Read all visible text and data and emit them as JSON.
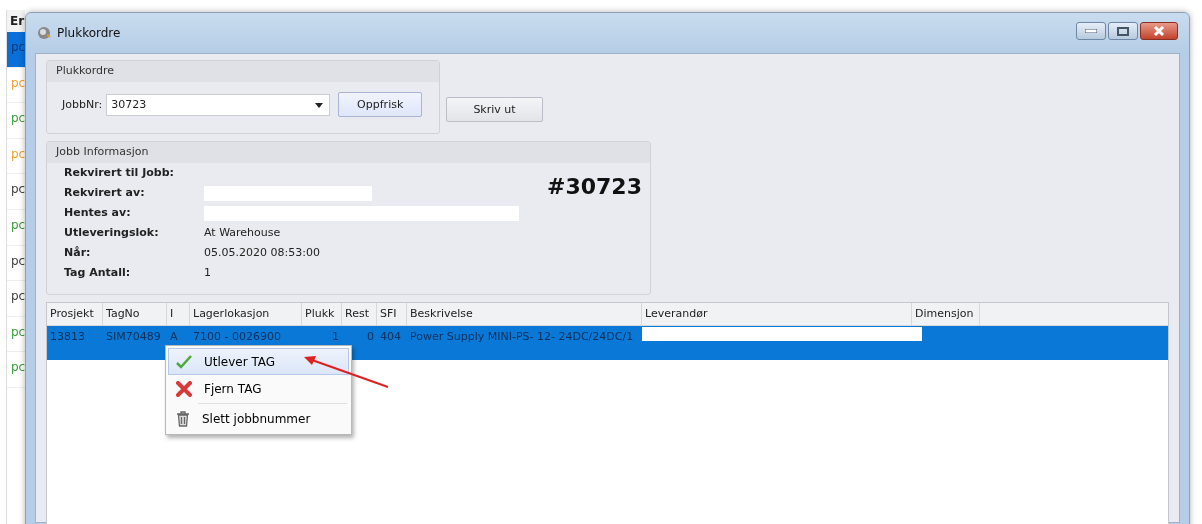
{
  "background_list": {
    "header": "Er",
    "rows": [
      {
        "text": "pc",
        "color": "#0a3a78",
        "selected": true
      },
      {
        "text": "pc",
        "color": "#f0a030",
        "selected": false
      },
      {
        "text": "pc",
        "color": "#3a9a3a",
        "selected": false
      },
      {
        "text": "pc",
        "color": "#f0a030",
        "selected": false
      },
      {
        "text": "pc",
        "color": "#404040",
        "selected": false
      },
      {
        "text": "pc",
        "color": "#3a9a3a",
        "selected": false
      },
      {
        "text": "pc",
        "color": "#404040",
        "selected": false
      },
      {
        "text": "pc",
        "color": "#404040",
        "selected": false
      },
      {
        "text": "pc",
        "color": "#3a9a3a",
        "selected": false
      },
      {
        "text": "pc",
        "color": "#3a9a3a",
        "selected": false
      }
    ]
  },
  "window": {
    "title": "Plukkordre"
  },
  "plukkordre_group": {
    "title": "Plukkordre",
    "jobbnr_label": "JobbNr:",
    "jobbnr_value": "30723",
    "refresh_button": "Oppfrisk"
  },
  "print_button": "Skriv ut",
  "job_info": {
    "title": "Jobb Informasjon",
    "job_number": "#30723",
    "fields": [
      {
        "label": "Rekvirert til Jobb:",
        "kind": "text"
      },
      {
        "label": "Rekvirert av:",
        "kind": "redacted"
      },
      {
        "label": "Hentes av:",
        "kind": "redacted_long"
      },
      {
        "label": "Utleveringslok:",
        "kind": "text",
        "value": "At Warehouse"
      },
      {
        "label": "Når:",
        "kind": "text",
        "value": "05.05.2020 08:53:00"
      },
      {
        "label": "Tag Antall:",
        "kind": "text",
        "value": "1"
      }
    ]
  },
  "table": {
    "columns": [
      "Prosjekt",
      "TagNo",
      "I",
      "Lagerlokasjon",
      "Plukk",
      "Rest",
      "SFI",
      "Beskrivelse",
      "Leverandør",
      "Dimensjon"
    ],
    "rows": [
      {
        "selected": true,
        "cells": [
          "13813",
          "SIM70489",
          "A",
          "7100 - 0026900",
          "1",
          "0",
          "404",
          "Power Supply MINI-PS- 12- 24DC/24DC/1",
          null
        ]
      }
    ]
  },
  "context_menu": {
    "items": [
      {
        "label": "Utlever TAG",
        "kind": "check",
        "selected": true
      },
      {
        "label": "Fjern TAG",
        "kind": "remove",
        "selected": false
      },
      {
        "label": "Slett jobbnummer",
        "kind": "trash",
        "selected": false
      }
    ]
  }
}
